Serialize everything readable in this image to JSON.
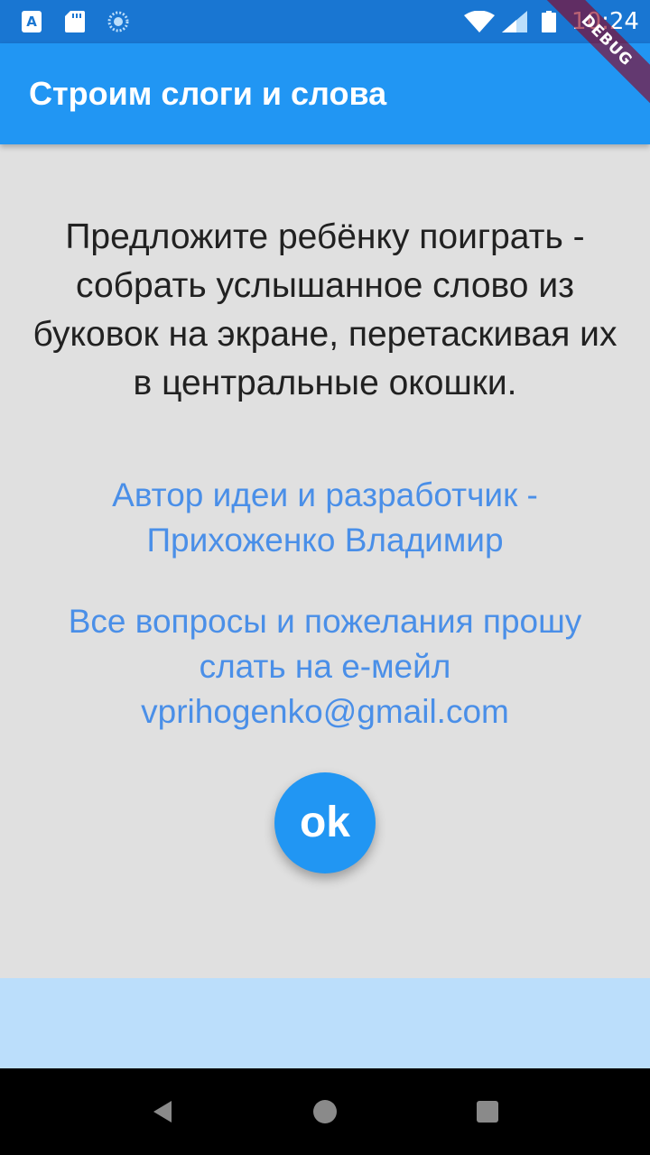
{
  "status_bar": {
    "time": "10:24",
    "icons": [
      "app-a-icon",
      "sd-card-icon",
      "sync-icon",
      "wifi-icon",
      "signal-icon",
      "battery-icon"
    ],
    "app_icon_letter": "A"
  },
  "debug_banner": "DEBUG",
  "app_bar": {
    "title": "Строим слоги и слова"
  },
  "main": {
    "instruction": "Предложите ребёнку поиграть - собрать услышанное слово из буковок на экране, перетаскивая их в центральные окошки.",
    "author": "Автор идеи и разработчик - Прихоженко Владимир",
    "contact": "Все вопросы и пожелания прошу слать на е-мейл vprihogenko@gmail.com",
    "ok_label": "ok"
  },
  "nav_bar": {
    "icons": [
      "back-icon",
      "home-icon",
      "recents-icon"
    ]
  },
  "colors": {
    "status_bar": "#1976d2",
    "app_bar": "#2196f3",
    "background": "#e0e0e0",
    "link_text": "#4a8fe8",
    "bottom_panel": "#bbdefb",
    "debug_ribbon": "#8c001e"
  }
}
